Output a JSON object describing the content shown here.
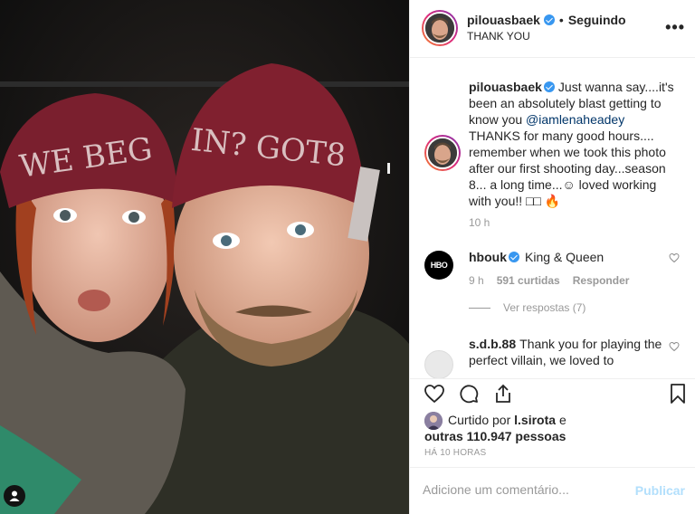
{
  "post": {
    "username": "pilouasbaek",
    "follow_label": "Seguindo",
    "location": "THANK YOU",
    "more_label": "•••"
  },
  "photo": {
    "beanie_left_text": "WE BEG",
    "beanie_right_text": "IN? GOT8"
  },
  "caption": {
    "username": "pilouasbaek",
    "text_before": "Just wanna say....it's been an absolutely blast getting to know you ",
    "mention": "@iamlenaheadey",
    "text_after": " THANKS for many good hours.... remember when we took this photo after our first shooting day...season 8... a long time...☺ loved working with you!! □□ 🔥",
    "time": "10 h"
  },
  "comments": [
    {
      "username": "hbouk",
      "avatar_text": "HBO",
      "text": "King & Queen",
      "time": "9 h",
      "likes": "591 curtidas",
      "reply_label": "Responder",
      "view_replies": "Ver respostas (7)"
    },
    {
      "username": "s.d.b.88",
      "text": "Thank you for playing the perfect villain, we loved to"
    }
  ],
  "likes": {
    "prefix": "Curtido por ",
    "user": "l.sirota",
    "middle": " e",
    "others": "outras 110.947 pessoas"
  },
  "timeago": "HÁ 10 HORAS",
  "add_comment": {
    "placeholder": "Adicione um comentário...",
    "publish_label": "Publicar"
  },
  "colors": {
    "accent": "#3897f0",
    "mention": "#003569",
    "publish_disabled": "#b2dffc"
  }
}
